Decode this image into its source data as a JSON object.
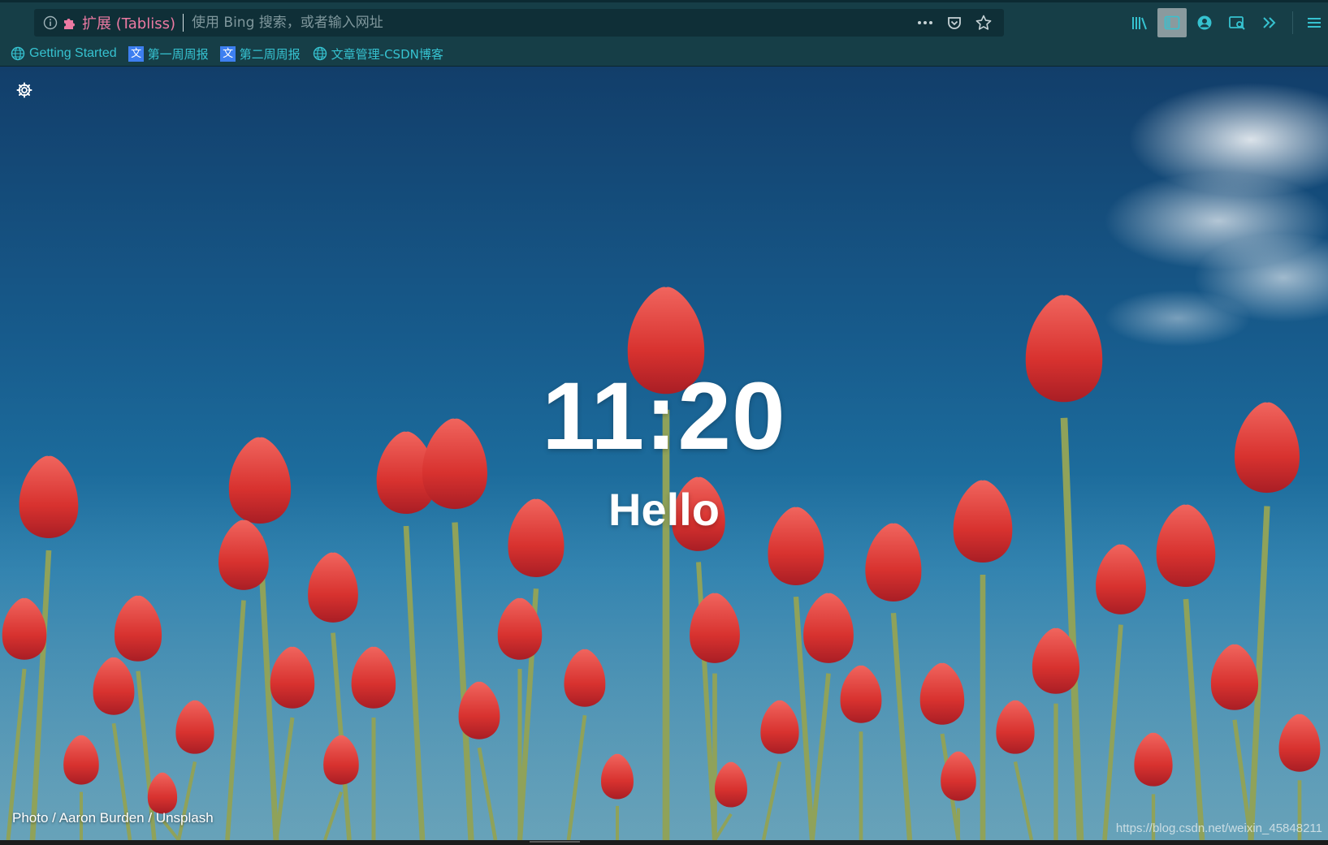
{
  "browser": {
    "identity_label": "扩展 (Tabliss)",
    "url_placeholder": "使用 Bing 搜索，或者输入网址",
    "url_value": "",
    "icons": {
      "site_info": "info-icon",
      "extension": "puzzle-icon",
      "page_actions": "more-dots-icon",
      "pocket": "pocket-icon",
      "bookmark": "star-icon",
      "library": "library-icon",
      "sidebar": "sidebar-icon",
      "account": "account-icon",
      "screenshot": "screenshot-icon",
      "overflow": "chevron-double-right-icon",
      "menu": "hamburger-menu-icon"
    },
    "colors": {
      "chrome": "#163e47",
      "accent": "#36c2d0",
      "identity": "#ec7aa3"
    }
  },
  "bookmarks": [
    {
      "label": "Getting Started",
      "icon": "globe-icon"
    },
    {
      "label": "第一周周报",
      "icon": "translate-icon"
    },
    {
      "label": "第二周周报",
      "icon": "translate-icon"
    },
    {
      "label": "文章管理-CSDN博客",
      "icon": "globe-icon"
    }
  ],
  "newtab": {
    "time": "11:20",
    "greeting": "Hello",
    "credit": {
      "photo": "Photo",
      "sep": "/",
      "author": "Aaron Burden",
      "source": "Unsplash"
    },
    "settings_icon": "gear-icon",
    "background": "tulip-photo"
  },
  "watermark": "https://blog.csdn.net/weixin_45848211"
}
